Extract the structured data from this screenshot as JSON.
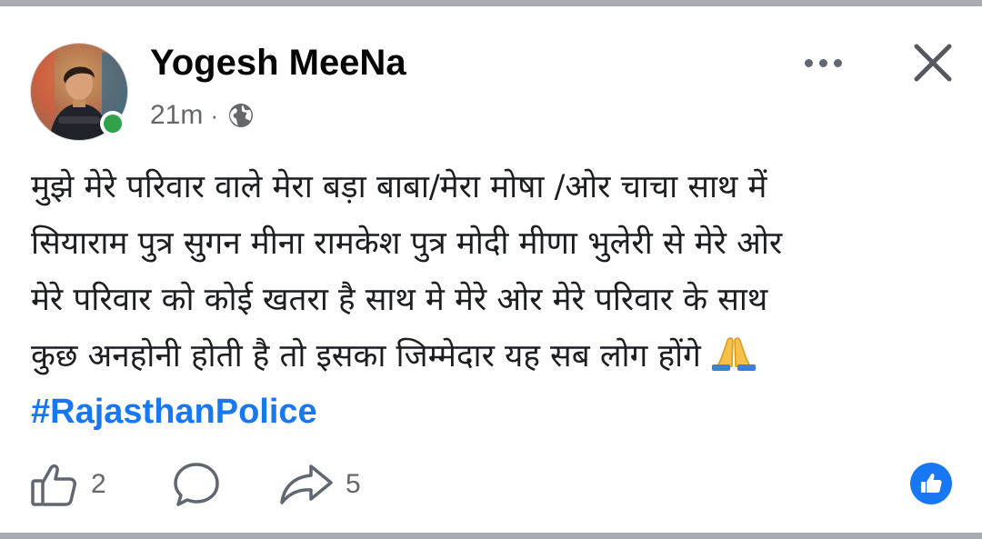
{
  "post": {
    "author_name": "Yogesh MeeNa",
    "timestamp": "21m",
    "separator": "·",
    "privacy_icon": "globe-icon",
    "text_lines": [
      "मुझे मेरे परिवार वाले मेरा बड़ा बाबा/मेरा मोषा /ओर चाचा साथ में",
      "सियाराम पुत्र सुगन मीना रामकेश पुत्र मोदी मीणा भुलेरी से मेरे ओर",
      "मेरे परिवार को कोई खतरा है साथ मे मेरे ओर मेरे परिवार के साथ",
      "कुछ अनहोनी होती है तो इसका जिम्मेदार यह सब लोग होंगे"
    ],
    "emoji": "🙏",
    "hashtag": "#RajasthanPolice",
    "online_status": true
  },
  "actions": {
    "like_count": "2",
    "share_count": "5",
    "like_icon": "thumbs-up-icon",
    "comment_icon": "comment-bubble-icon",
    "share_icon": "share-arrow-icon"
  },
  "colors": {
    "accent": "#1877f2",
    "online": "#31a24c",
    "secondary_text": "#65676b"
  }
}
